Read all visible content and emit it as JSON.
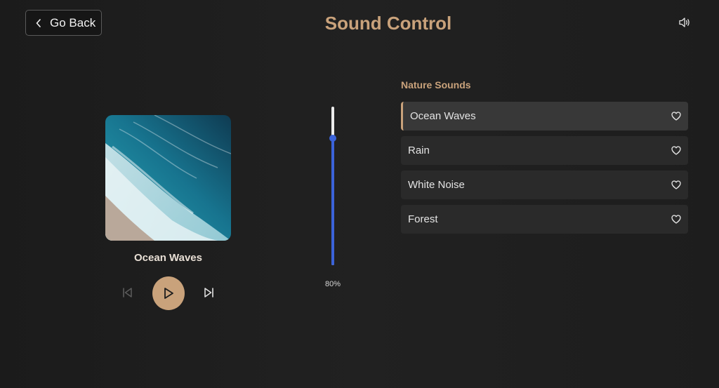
{
  "header": {
    "back_label": "Go Back",
    "title": "Sound Control"
  },
  "player": {
    "track_title": "Ocean Waves",
    "cover_alt": "Ocean waves aerial photo"
  },
  "volume": {
    "level": 0.8,
    "label": "80%"
  },
  "sounds": {
    "heading": "Nature Sounds",
    "items": [
      {
        "label": "Ocean Waves",
        "active": true
      },
      {
        "label": "Rain",
        "active": false
      },
      {
        "label": "White Noise",
        "active": false
      },
      {
        "label": "Forest",
        "active": false
      }
    ]
  },
  "colors": {
    "accent": "#c9a27b",
    "slider": "#3b63d9",
    "background": "#1e1e1e"
  }
}
